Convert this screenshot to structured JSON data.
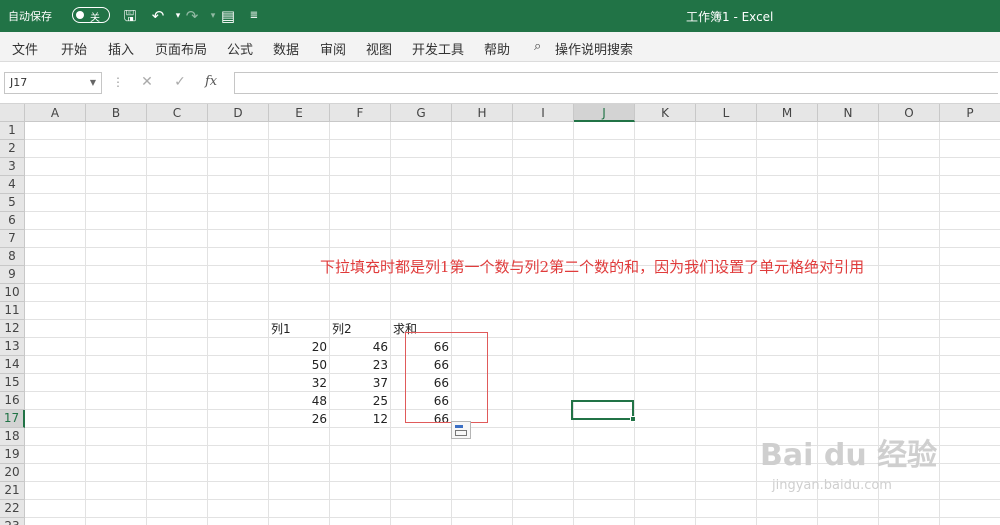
{
  "titlebar": {
    "autosave_label": "自动保存",
    "toggle_state": "关",
    "save_icon": "save-icon",
    "undo_icon": "undo-icon",
    "redo_icon": "redo-icon",
    "form_icon": "form-icon",
    "customize_icon": "customize-icon",
    "window_title": "工作簿1  -  Excel"
  },
  "menu": {
    "tabs": [
      "文件",
      "开始",
      "插入",
      "页面布局",
      "公式",
      "数据",
      "审阅",
      "视图",
      "开发工具",
      "帮助"
    ],
    "search_label": "操作说明搜索"
  },
  "formula_bar": {
    "name_box": "J17",
    "fx_label": "fx",
    "formula": ""
  },
  "grid": {
    "columns": [
      "A",
      "B",
      "C",
      "D",
      "E",
      "F",
      "G",
      "H",
      "I",
      "J",
      "K",
      "L",
      "M",
      "N",
      "O",
      "P"
    ],
    "rows": [
      "1",
      "2",
      "3",
      "4",
      "5",
      "6",
      "7",
      "8",
      "9",
      "10",
      "11",
      "12",
      "13",
      "14",
      "15",
      "16",
      "17",
      "18",
      "19",
      "20",
      "21",
      "22",
      "23"
    ],
    "active_column": "J",
    "active_row": "17"
  },
  "sheet": {
    "annotation": "下拉填充时都是列1第一个数与列2第二个数的和，因为我们设置了单元格绝对引用",
    "headers": {
      "col1": "列1",
      "col2": "列2",
      "sum": "求和"
    },
    "table": [
      {
        "col1": "20",
        "col2": "46",
        "sum": "66"
      },
      {
        "col1": "50",
        "col2": "23",
        "sum": "66"
      },
      {
        "col1": "32",
        "col2": "37",
        "sum": "66"
      },
      {
        "col1": "48",
        "col2": "25",
        "sum": "66"
      },
      {
        "col1": "26",
        "col2": "12",
        "sum": "66"
      }
    ]
  },
  "watermark": {
    "brand": "Bai du 经验",
    "url": "jingyan.baidu.com"
  }
}
